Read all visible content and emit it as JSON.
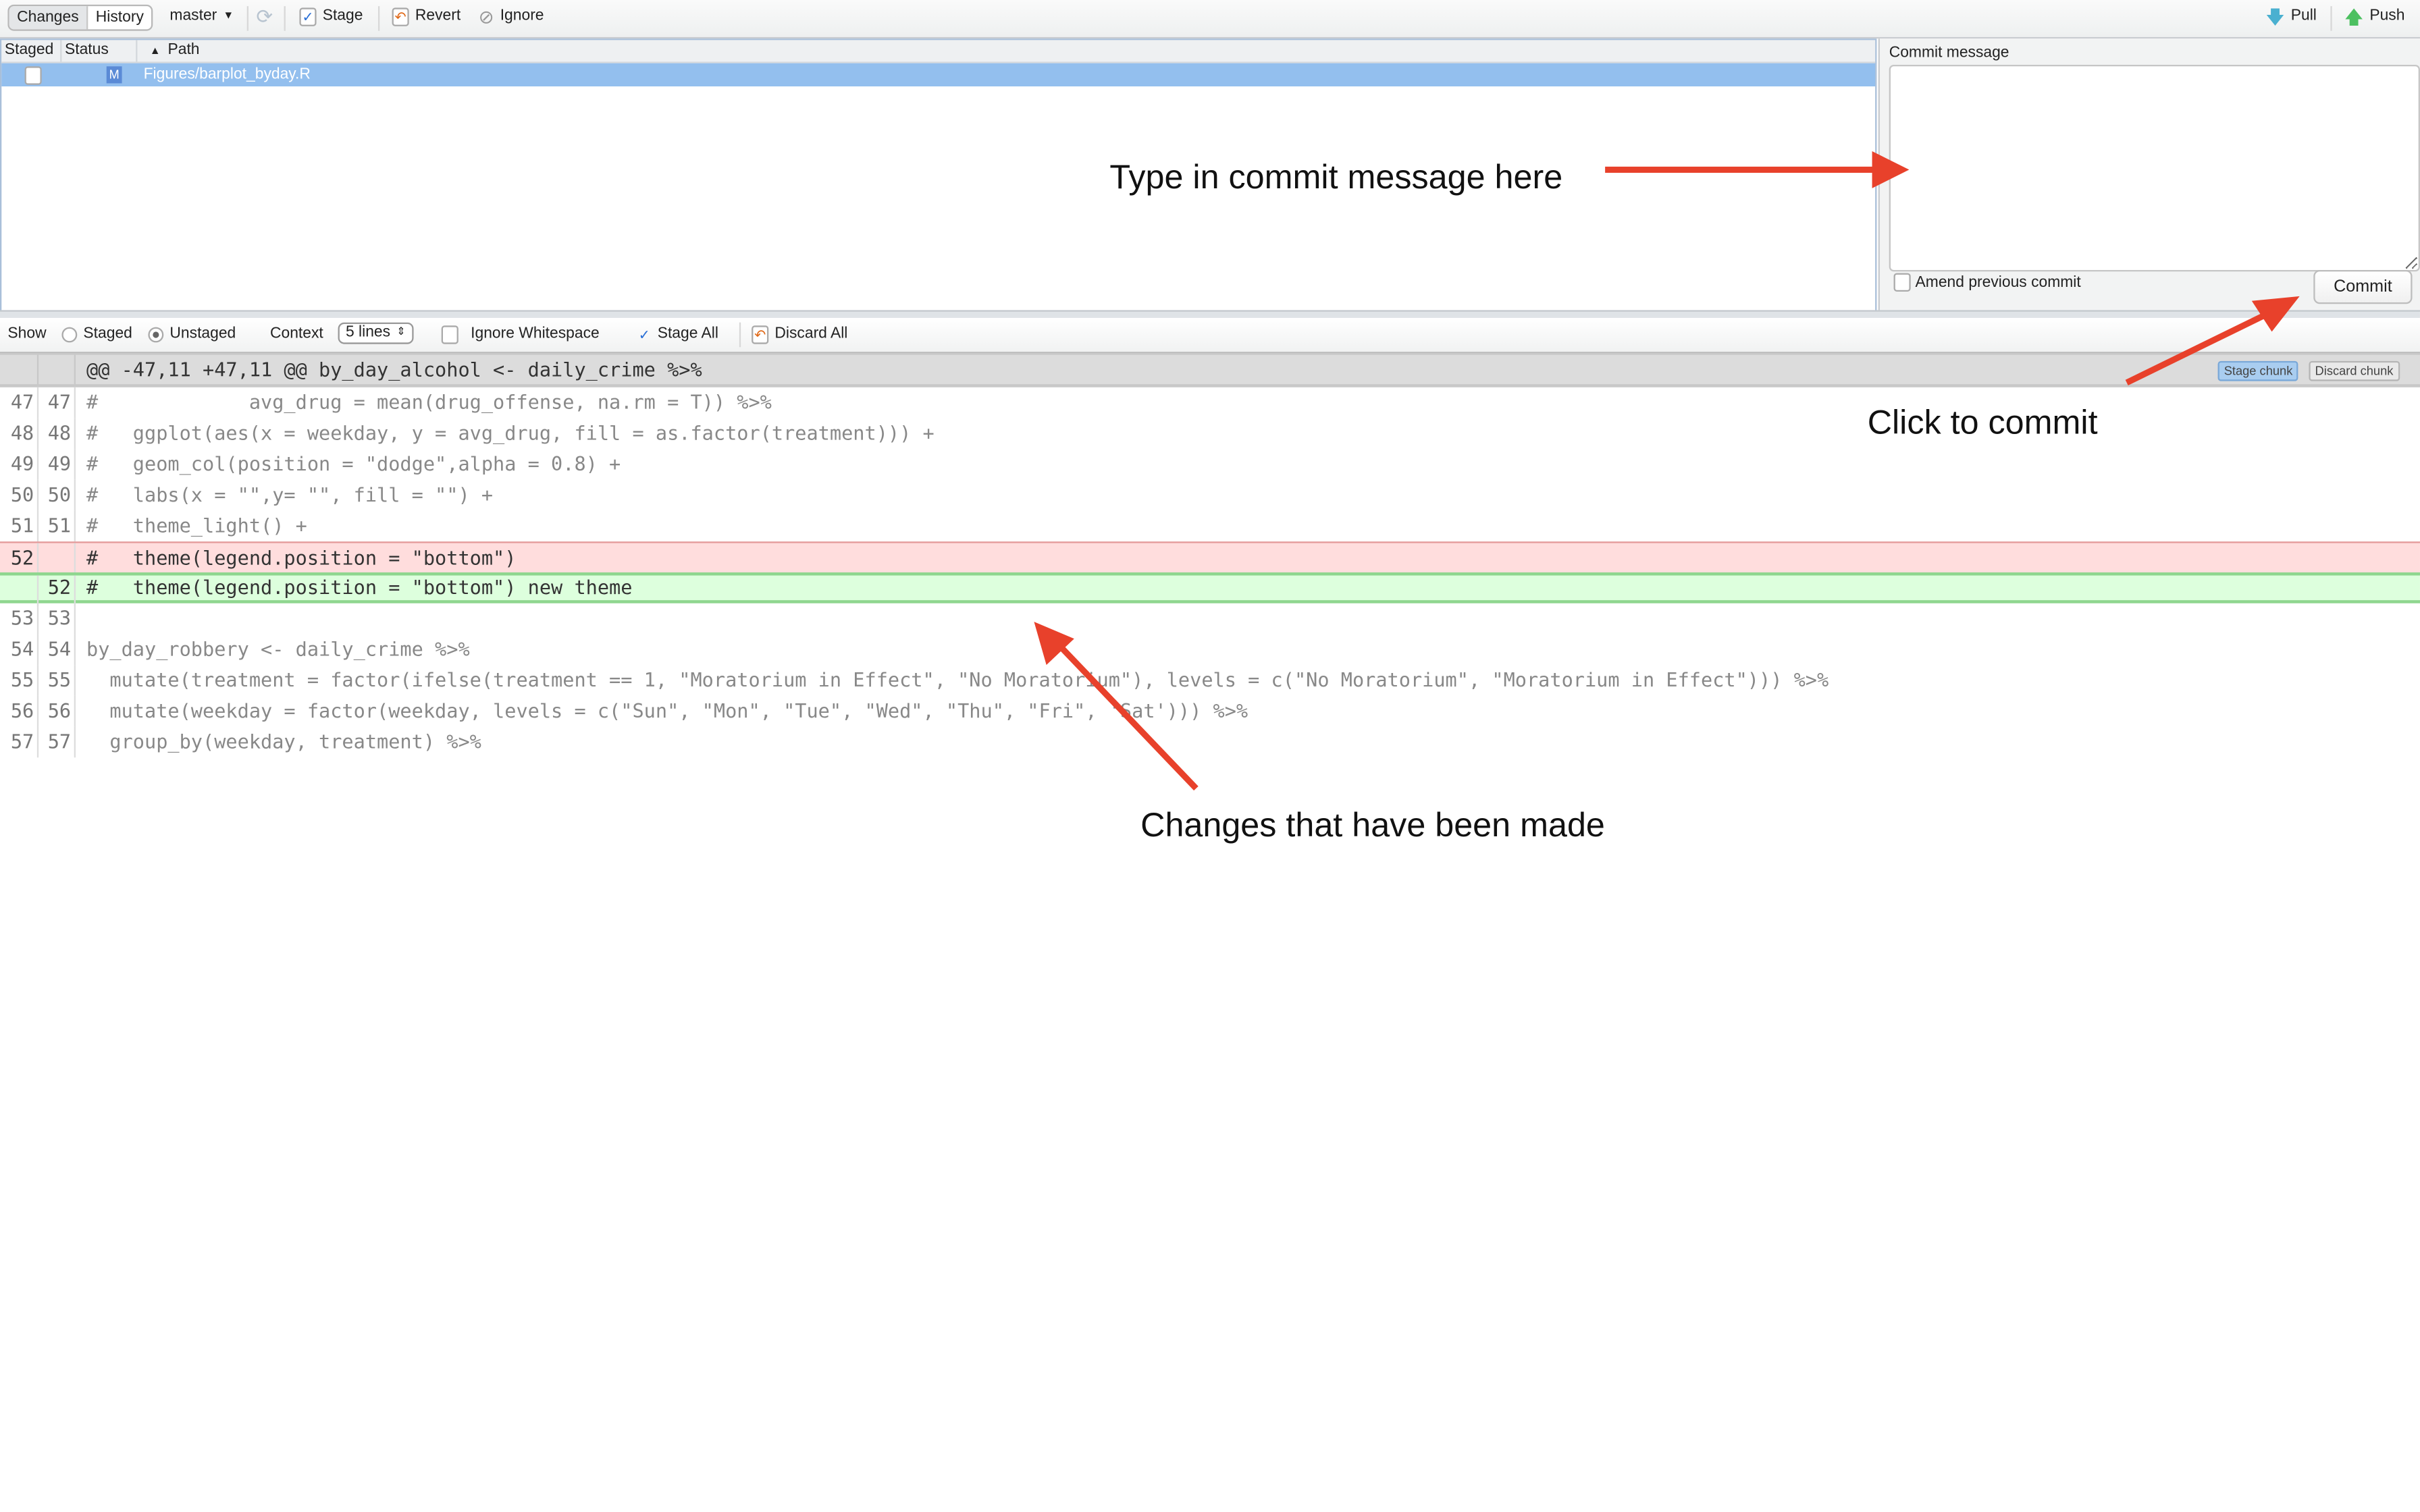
{
  "toolbar": {
    "tabs": [
      {
        "label": "Changes",
        "active": true
      },
      {
        "label": "History",
        "active": false
      }
    ],
    "branch": "master",
    "refresh_icon": "refresh-icon",
    "stage_label": "Stage",
    "revert_label": "Revert",
    "ignore_label": "Ignore",
    "pull_label": "Pull",
    "push_label": "Push"
  },
  "file_list": {
    "columns": [
      "Staged",
      "Status",
      "Path"
    ],
    "sort_indicator": "▲",
    "rows": [
      {
        "staged": false,
        "status": "M",
        "path": "Figures/barplot_byday.R",
        "selected": true
      }
    ]
  },
  "commit": {
    "message_label": "Commit message",
    "message_value": "",
    "amend_label": "Amend previous commit",
    "amend_checked": false,
    "commit_button": "Commit"
  },
  "diff_toolbar": {
    "show_label": "Show",
    "staged_label": "Staged",
    "unstaged_label": "Unstaged",
    "selected_view": "Unstaged",
    "context_label": "Context",
    "context_value": "5 lines",
    "ignore_whitespace_label": "Ignore Whitespace",
    "stage_all_label": "Stage All",
    "discard_all_label": "Discard All"
  },
  "diff": {
    "hunk_header": "@@ -47,11 +47,11 @@ by_day_alcohol <- daily_crime %>%",
    "stage_chunk": "Stage chunk",
    "discard_chunk": "Discard chunk",
    "lines": [
      {
        "old": "47",
        "new": "47",
        "type": "context",
        "text": "#             avg_drug = mean(drug_offense, na.rm = T)) %>%"
      },
      {
        "old": "48",
        "new": "48",
        "type": "context",
        "text": "#   ggplot(aes(x = weekday, y = avg_drug, fill = as.factor(treatment))) +"
      },
      {
        "old": "49",
        "new": "49",
        "type": "context",
        "text": "#   geom_col(position = \"dodge\",alpha = 0.8) +"
      },
      {
        "old": "50",
        "new": "50",
        "type": "context",
        "text": "#   labs(x = \"\",y= \"\", fill = \"\") +"
      },
      {
        "old": "51",
        "new": "51",
        "type": "context",
        "text": "#   theme_light() +"
      },
      {
        "old": "52",
        "new": "",
        "type": "del",
        "text": "#   theme(legend.position = \"bottom\")"
      },
      {
        "old": "",
        "new": "52",
        "type": "add",
        "text": "#   theme(legend.position = \"bottom\") new theme"
      },
      {
        "old": "53",
        "new": "53",
        "type": "context",
        "text": ""
      },
      {
        "old": "54",
        "new": "54",
        "type": "context",
        "text": "by_day_robbery <- daily_crime %>%"
      },
      {
        "old": "55",
        "new": "55",
        "type": "context",
        "text": "  mutate(treatment = factor(ifelse(treatment == 1, \"Moratorium in Effect\", \"No Moratorium\"), levels = c(\"No Moratorium\", \"Moratorium in Effect\"))) %>%"
      },
      {
        "old": "56",
        "new": "56",
        "type": "context",
        "text": "  mutate(weekday = factor(weekday, levels = c(\"Sun\", \"Mon\", \"Tue\", \"Wed\", \"Thu\", \"Fri\", 'Sat'))) %>%"
      },
      {
        "old": "57",
        "new": "57",
        "type": "context",
        "text": "  group_by(weekday, treatment) %>%"
      }
    ]
  },
  "annotations": {
    "commit_message": "Type in commit message here",
    "click_commit": "Click to commit",
    "changes": "Changes that have been made",
    "arrow_color": "#e8412b"
  }
}
